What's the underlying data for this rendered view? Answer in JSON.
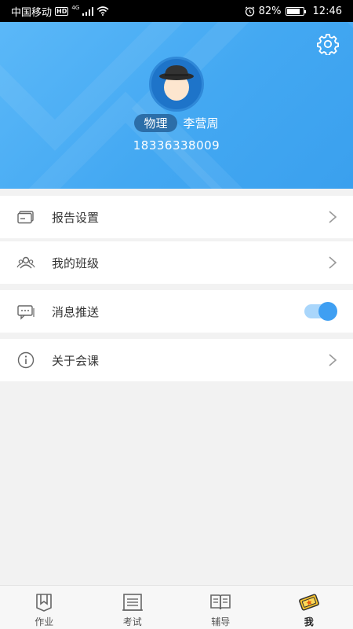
{
  "status_bar": {
    "carrier": "中国移动",
    "hd": "HD",
    "network": "4G",
    "battery": "82%",
    "battery_level": 0.82,
    "time": "12:46"
  },
  "profile": {
    "subject": "物理",
    "name": "李营周",
    "phone": "18336338009"
  },
  "menu": {
    "items": [
      {
        "label": "报告设置",
        "icon": "card-icon",
        "control": "chevron"
      },
      {
        "label": "我的班级",
        "icon": "group-icon",
        "control": "chevron"
      },
      {
        "label": "消息推送",
        "icon": "message-icon",
        "control": "toggle",
        "enabled": true
      },
      {
        "label": "关于会课",
        "icon": "info-icon",
        "control": "chevron"
      }
    ]
  },
  "tabs": [
    {
      "label": "作业",
      "icon": "homework-icon",
      "active": false
    },
    {
      "label": "考试",
      "icon": "exam-icon",
      "active": false
    },
    {
      "label": "辅导",
      "icon": "tutoring-icon",
      "active": false
    },
    {
      "label": "我",
      "icon": "me-icon",
      "active": true
    }
  ],
  "colors": {
    "header_blue": "#43a8f2",
    "accent": "#3f9ff2",
    "subject_badge": "#2c6ea8"
  }
}
